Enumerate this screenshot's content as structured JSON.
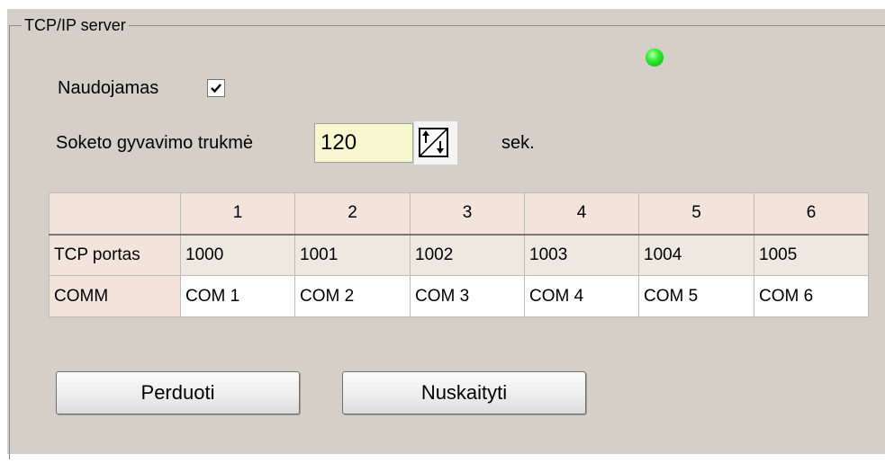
{
  "group": {
    "title": "TCP/IP server"
  },
  "status": {
    "indicator_color": "#22dd22"
  },
  "in_use": {
    "label": "Naudojamas",
    "checked": true
  },
  "socket_lifetime": {
    "label": "Soketo gyvavimo trukmė",
    "value": "120",
    "unit": "sek."
  },
  "table": {
    "columns": [
      "1",
      "2",
      "3",
      "4",
      "5",
      "6"
    ],
    "rows": [
      {
        "label": "TCP portas",
        "values": [
          "1000",
          "1001",
          "1002",
          "1003",
          "1004",
          "1005"
        ]
      },
      {
        "label": "COMM",
        "values": [
          "COM 1",
          "COM 2",
          "COM 3",
          "COM 4",
          "COM 5",
          "COM 6"
        ]
      }
    ]
  },
  "buttons": {
    "send": "Perduoti",
    "read": "Nuskaityti"
  },
  "colors": {
    "panel_bg": "#d4d0c8",
    "header_bg": "#f2e4da",
    "port_row_bg": "#ede8e0",
    "input_bg": "#f7f7d0"
  }
}
